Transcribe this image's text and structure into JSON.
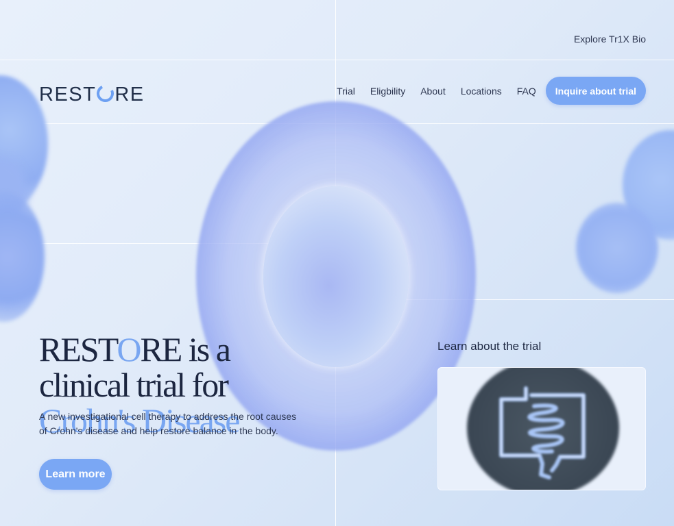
{
  "topbar": {
    "explore_link": "Explore Tr1X Bio"
  },
  "brand": {
    "logo_prefix": "REST",
    "logo_suffix": "RE",
    "accent_color": "#79a6f1"
  },
  "nav": {
    "items": [
      {
        "label": "Trial"
      },
      {
        "label": "Eligbility"
      },
      {
        "label": "About"
      },
      {
        "label": "Locations"
      },
      {
        "label": "FAQ"
      }
    ],
    "cta_label": "Inquire about trial"
  },
  "hero": {
    "title_part1": "REST",
    "title_o": "O",
    "title_part2": "RE is a clinical trial for ",
    "title_accent": "Crohn's Disease",
    "subtitle": "A new investigational cell therapy to address the root causes of Crohn's disease and help restore balance in the body.",
    "button_label": "Learn more"
  },
  "trial_section": {
    "heading": "Learn about the trial",
    "video_icon": "intestine-icon"
  }
}
